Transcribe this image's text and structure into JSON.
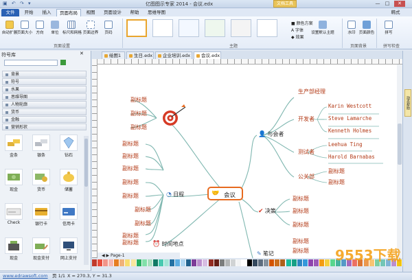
{
  "window": {
    "title": "亿图图示专家 2014 - 会议.edx",
    "context_tab": "文档工具",
    "controls": [
      "—",
      "□",
      "✕"
    ],
    "user": "韩式"
  },
  "menu_tabs": [
    "文件",
    "开始",
    "插入",
    "页面布局",
    "视图",
    "页面设计",
    "帮助",
    "思维导图"
  ],
  "ribbon": {
    "page_setup_buttons": [
      "自动扩展",
      "页面大小",
      "方向",
      "单位",
      "标尺和网格",
      "页面边界",
      "页码"
    ],
    "page_setup_group": "页面设置",
    "theme_group": "主题",
    "theme_options": [
      "颜色方案",
      "字体",
      "效果"
    ],
    "set_default_theme": "设置默认主题",
    "background_buttons": [
      "水印",
      "页面颜色"
    ],
    "background_group": "页面背景",
    "spell_button": "拼写",
    "spell_group": "拼写检查"
  },
  "left_panel": {
    "title": "符号库",
    "categories": [
      "背景",
      "符号",
      "水果",
      "思维导图",
      "人物轮廓",
      "货币",
      "金融",
      "营销形状"
    ],
    "shapes": [
      {
        "label": "金条",
        "icon": "gold-bars-icon"
      },
      {
        "label": "银条",
        "icon": "silver-bars-icon"
      },
      {
        "label": "钻石",
        "icon": "diamond-icon"
      },
      {
        "label": "现金",
        "icon": "cash-icon"
      },
      {
        "label": "货币",
        "icon": "coins-icon"
      },
      {
        "label": "储蓄",
        "icon": "piggy-bank-icon"
      },
      {
        "label": "Check",
        "icon": "check-icon"
      },
      {
        "label": "银行卡",
        "icon": "bank-card-icon"
      },
      {
        "label": "信用卡",
        "icon": "credit-card-icon"
      },
      {
        "label": "现金",
        "icon": "cash-register-icon"
      },
      {
        "label": "现金支付",
        "icon": "cash-pay-icon"
      },
      {
        "label": "网上支付",
        "icon": "online-pay-icon"
      }
    ],
    "footer_tabs": [
      "符号库",
      "文件恢复"
    ]
  },
  "doc_tabs": [
    "绘图1",
    "生日.edx",
    "企业培训.edx",
    "会议.edx"
  ],
  "active_doc_tab": 3,
  "right_strip_label": "动态帮助",
  "mindmap": {
    "center": "会议",
    "branches": {
      "attendees": "与会者",
      "schedule": "日程",
      "location": "时间地点",
      "decision": "决策",
      "notes": "笔记"
    },
    "attendee_groups": [
      "生产部经理",
      "开发者",
      "测试者",
      "公关部"
    ],
    "developers": [
      "Karin Westcott",
      "Steve Lamarche",
      "Kenneth Holmes"
    ],
    "testers": [
      "Leehua Ting",
      "Harold Barnabas"
    ],
    "pr": [
      "副标题",
      "副标题"
    ],
    "target_subs": [
      "副标题",
      "副标题",
      "副标题"
    ],
    "schedule_subs": [
      "副标题",
      "副标题",
      "副标题",
      "副标题",
      "副标题",
      "副标题",
      "副标题",
      "副标题",
      "副标题"
    ],
    "decision_subs": [
      "副标题",
      "副标题",
      "副标题"
    ],
    "notes_subs": [
      "副标题",
      "副标题",
      "副标题"
    ],
    "location_subs": [
      "副标题"
    ]
  },
  "page_nav": "Page-1",
  "palette": [
    "#c0392b",
    "#e74c3c",
    "#f1948a",
    "#f5b7b1",
    "#e67e22",
    "#f0b27a",
    "#f7dc6f",
    "#f9e79f",
    "#27ae60",
    "#82e0aa",
    "#a9dfbf",
    "#117a65",
    "#48c9b0",
    "#a3e4d7",
    "#2471a3",
    "#5dade2",
    "#aed6f1",
    "#1f618d",
    "#7d3c98",
    "#bb8fce",
    "#d7bde2",
    "#922b21",
    "#641e16",
    "#7b7d7d",
    "#b3b6b7",
    "#d0d3d4",
    "#f2f3f4",
    "#ffffff",
    "#000000",
    "#34495e",
    "#5d6d7e",
    "#85929e",
    "#d35400",
    "#ca6f1e",
    "#af601a",
    "#1abc9c",
    "#16a085",
    "#2e86c1",
    "#3498db",
    "#8e44ad",
    "#9b59b6",
    "#f39c12",
    "#f4d03f",
    "#58d68d",
    "#45b39d",
    "#5499c7",
    "#a569bd",
    "#ec7063",
    "#dc7633",
    "#eb984e",
    "#f8c471",
    "#7dcea0",
    "#73c6b6",
    "#7fb3d5",
    "#bb8fce",
    "#f1c40f"
  ],
  "status": {
    "url": "www.edrawsoft.com",
    "page": "页 1/1",
    "coords": "X = 270.3, Y = 31.3"
  },
  "watermark": "9553下载"
}
